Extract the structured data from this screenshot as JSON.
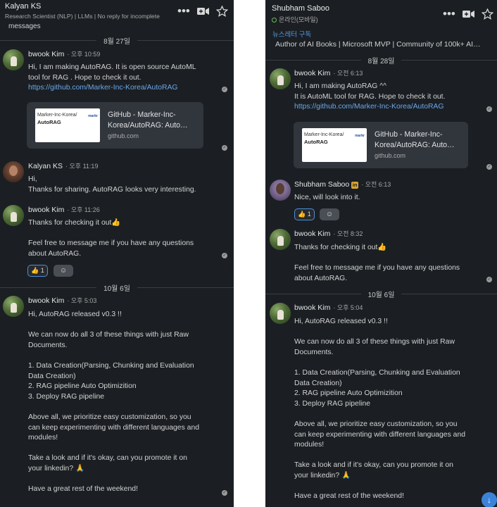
{
  "left": {
    "header": {
      "name": "Kalyan KS",
      "subtitle": "Research Scientist (NLP) | LLMs | No reply for incomplete"
    },
    "top_fragment": "messages",
    "date1": "8월 27일",
    "m1": {
      "sender": "bwook Kim",
      "time": "· 오후 10:59",
      "text": "Hi, I am making AutoRAG. It is open source AutoML\ntool for RAG . Hope to check it out.",
      "link": "https://github.com/Marker-Inc-Korea/AutoRAG"
    },
    "preview": {
      "thumb_org": "Marker-Inc-Korea/",
      "thumb_repo": "AutoRAG",
      "thumb_logo": "markr",
      "title": "GitHub - Marker-Inc-\nKorea/AutoRAG: Auto…",
      "url": "github.com"
    },
    "m2": {
      "sender": "Kalyan KS",
      "time": "· 오후 11:19",
      "text": "Hi,\n  Thanks for sharing. AutoRAG looks very interesting."
    },
    "m3": {
      "sender": "bwook Kim",
      "time": "· 오후 11:26",
      "text": "Thanks for checking it out👍\n\nFeel free to message me if you have any questions\nabout AutoRAG.",
      "reaction": "👍 1"
    },
    "date2": "10월 6일",
    "m4": {
      "sender": "bwook Kim",
      "time": "· 오후 5:03",
      "text": "Hi, AutoRAG released v0.3 !!\n\nWe can now do all 3 of these things with just Raw\nDocuments.\n\n1. Data Creation(Parsing, Chunking and Evaluation\nData Creation)\n2. RAG pipeline Auto Optimizition\n3. Deploy RAG pipeline\n\nAbove all, we prioritize easy customization, so you\ncan keep experimenting with different languages and\nmodules!\n\nTake a look and if it's okay, can you promote it on\nyour linkedin? 🙏\n\nHave a great rest of the weekend!"
    }
  },
  "right": {
    "header": {
      "name": "Shubham Saboo",
      "status": "온라인(모바일)"
    },
    "newsletter": "뉴스레터 구독",
    "subtitle": "Author of AI Books | Microsoft MVP | Community of 100k+ AI…",
    "date1": "8월 28일",
    "m1": {
      "sender": "bwook Kim",
      "time": "· 오전 6:13",
      "text": "Hi, I am making AutoRAG ^^\nIt is AutoML tool for RAG. Hope to check it out.",
      "link": "https://github.com/Marker-Inc-Korea/AutoRAG"
    },
    "preview": {
      "thumb_org": "Marker-Inc-Korea/",
      "thumb_repo": "AutoRAG",
      "thumb_logo": "markr",
      "title": "GitHub - Marker-Inc-\nKorea/AutoRAG: Auto…",
      "url": "github.com"
    },
    "m2": {
      "sender": "Shubham Saboo",
      "badge": "in",
      "time": "· 오전 6:13",
      "text": "Nice, will look into it.",
      "reaction": "👍 1"
    },
    "m3": {
      "sender": "bwook Kim",
      "time": "· 오전 8:32",
      "text": "Thanks for checking it out👍\n\nFeel free to message me if you have any questions\nabout AutoRAG."
    },
    "date2": "10월 6일",
    "m4": {
      "sender": "bwook Kim",
      "time": "· 오후 5:04",
      "text": "Hi, AutoRAG released v0.3 !!\n\nWe can now do all 3 of these things with just Raw\nDocuments.\n\n1. Data Creation(Parsing, Chunking and Evaluation\nData Creation)\n2. RAG pipeline Auto Optimizition\n3. Deploy RAG pipeline\n\nAbove all, we prioritize easy customization, so you\ncan keep experimenting with different languages and\nmodules!\n\nTake a look and if it's okay, can you promote it on\nyour linkedin? 🙏\n\nHave a great rest of the weekend!"
    }
  },
  "icons": {
    "more": "more-icon",
    "video": "video-call-icon",
    "star": "star-icon",
    "read": "read-receipt-icon",
    "add_reaction": "add-reaction-icon",
    "scroll_down": "scroll-down-icon"
  }
}
